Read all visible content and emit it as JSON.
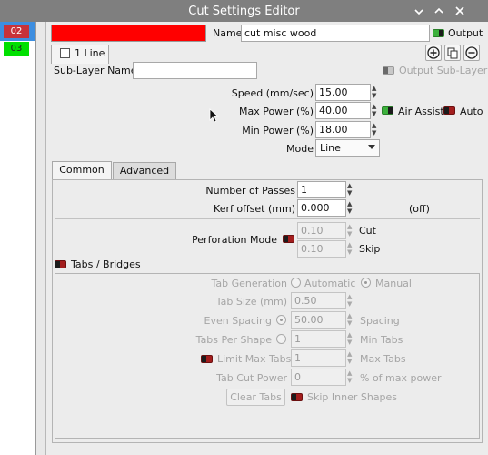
{
  "window": {
    "title": "Cut Settings Editor"
  },
  "layers": [
    {
      "id": "02",
      "color": "#c8323a"
    },
    {
      "id": "03",
      "color": "#00e000"
    }
  ],
  "header": {
    "layer_color": "#ff0000",
    "name_label": "Name",
    "name_value": "cut misc wood",
    "output_label": "Output"
  },
  "sublayer": {
    "tab_label": "1 Line",
    "name_label": "Sub-Layer Name",
    "name_value": "",
    "output_sublayer_label": "Output Sub-Layer"
  },
  "settings": {
    "speed_label": "Speed (mm/sec)",
    "speed_value": "15.00",
    "max_power_label": "Max Power (%)",
    "max_power_value": "40.00",
    "air_assist_label": "Air Assist",
    "auto_label": "Auto",
    "min_power_label": "Min Power (%)",
    "min_power_value": "18.00",
    "mode_label": "Mode",
    "mode_value": "Line"
  },
  "tabs": [
    {
      "label": "Common"
    },
    {
      "label": "Advanced"
    }
  ],
  "common": {
    "passes_label": "Number of Passes",
    "passes_value": "1",
    "kerf_label": "Kerf offset (mm)",
    "kerf_value": "0.000",
    "kerf_note": "(off)",
    "perforation_label": "Perforation Mode",
    "cut_value": "0.10",
    "cut_label": "Cut",
    "skip_value": "0.10",
    "skip_label": "Skip",
    "tabs_bridges_label": "Tabs / Bridges"
  },
  "tabsbox": {
    "generation_label": "Tab Generation",
    "automatic_label": "Automatic",
    "manual_label": "Manual",
    "tab_size_label": "Tab Size (mm)",
    "tab_size_value": "0.50",
    "even_spacing_label": "Even Spacing",
    "even_spacing_value": "50.00",
    "spacing_label": "Spacing",
    "tabs_per_shape_label": "Tabs Per Shape",
    "tabs_per_shape_value": "1",
    "min_tabs_label": "Min Tabs",
    "limit_max_label": "Limit Max Tabs",
    "limit_max_value": "1",
    "max_tabs_label": "Max Tabs",
    "tab_cut_power_label": "Tab Cut Power",
    "tab_cut_power_value": "0",
    "pct_label": "% of max power",
    "clear_tabs_label": "Clear Tabs",
    "skip_inner_label": "Skip Inner Shapes"
  }
}
